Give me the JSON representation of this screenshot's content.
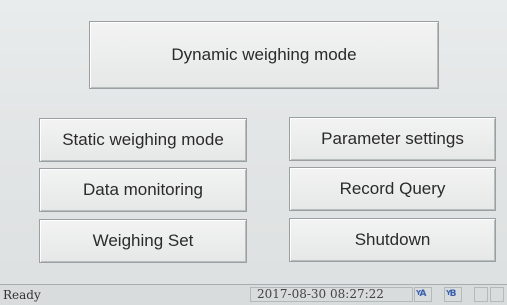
{
  "buttons": {
    "dynamic": "Dynamic weighing mode",
    "static": "Static weighing mode",
    "parameter": "Parameter settings",
    "monitoring": "Data monitoring",
    "record": "Record Query",
    "weighing_set": "Weighing Set",
    "shutdown": "Shutdown"
  },
  "status": {
    "text": "Ready",
    "datetime": "2017-08-30 08:27:22",
    "indicators": [
      "A",
      "B"
    ]
  }
}
